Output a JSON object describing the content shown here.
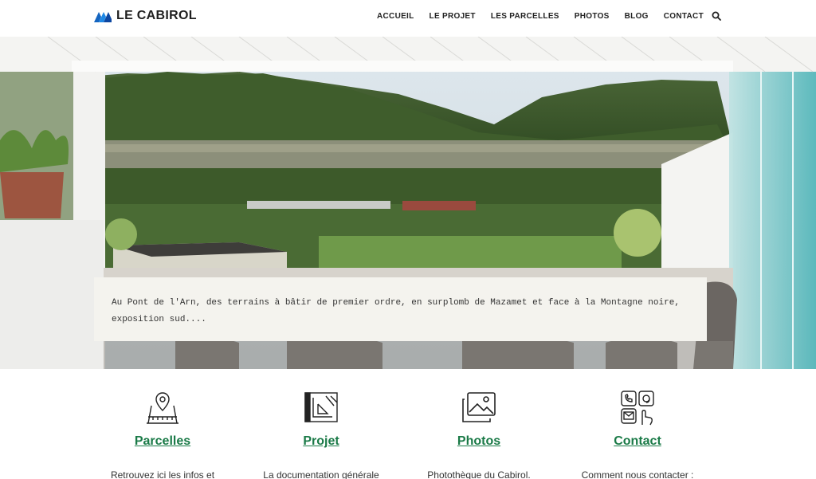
{
  "brand": {
    "name": "LE CABIROL",
    "logo_icon": "mountain-logo-icon",
    "logo_color": "#1565c0"
  },
  "nav": {
    "items": [
      {
        "label": "ACCUEIL"
      },
      {
        "label": "LE PROJET"
      },
      {
        "label": "LES PARCELLES"
      },
      {
        "label": "PHOTOS"
      },
      {
        "label": "BLOG"
      },
      {
        "label": "CONTACT"
      }
    ],
    "search_icon": "search-icon"
  },
  "hero": {
    "text": "Au Pont de l'Arn, des terrains à bâtir de premier ordre, en surplomb de Mazamet et face à la Montagne noire, exposition sud...."
  },
  "features": [
    {
      "icon": "map-pin-icon",
      "title": "Parcelles",
      "desc": "Retrouvez ici les infos et"
    },
    {
      "icon": "blueprint-icon",
      "title": "Projet",
      "desc": "La documentation générale"
    },
    {
      "icon": "photos-icon",
      "title": "Photos",
      "desc": "Photothèque du Cabirol."
    },
    {
      "icon": "contact-icon",
      "title": "Contact",
      "desc": "Comment nous contacter :"
    }
  ],
  "colors": {
    "accent": "#1a7a47",
    "text": "#222222"
  }
}
